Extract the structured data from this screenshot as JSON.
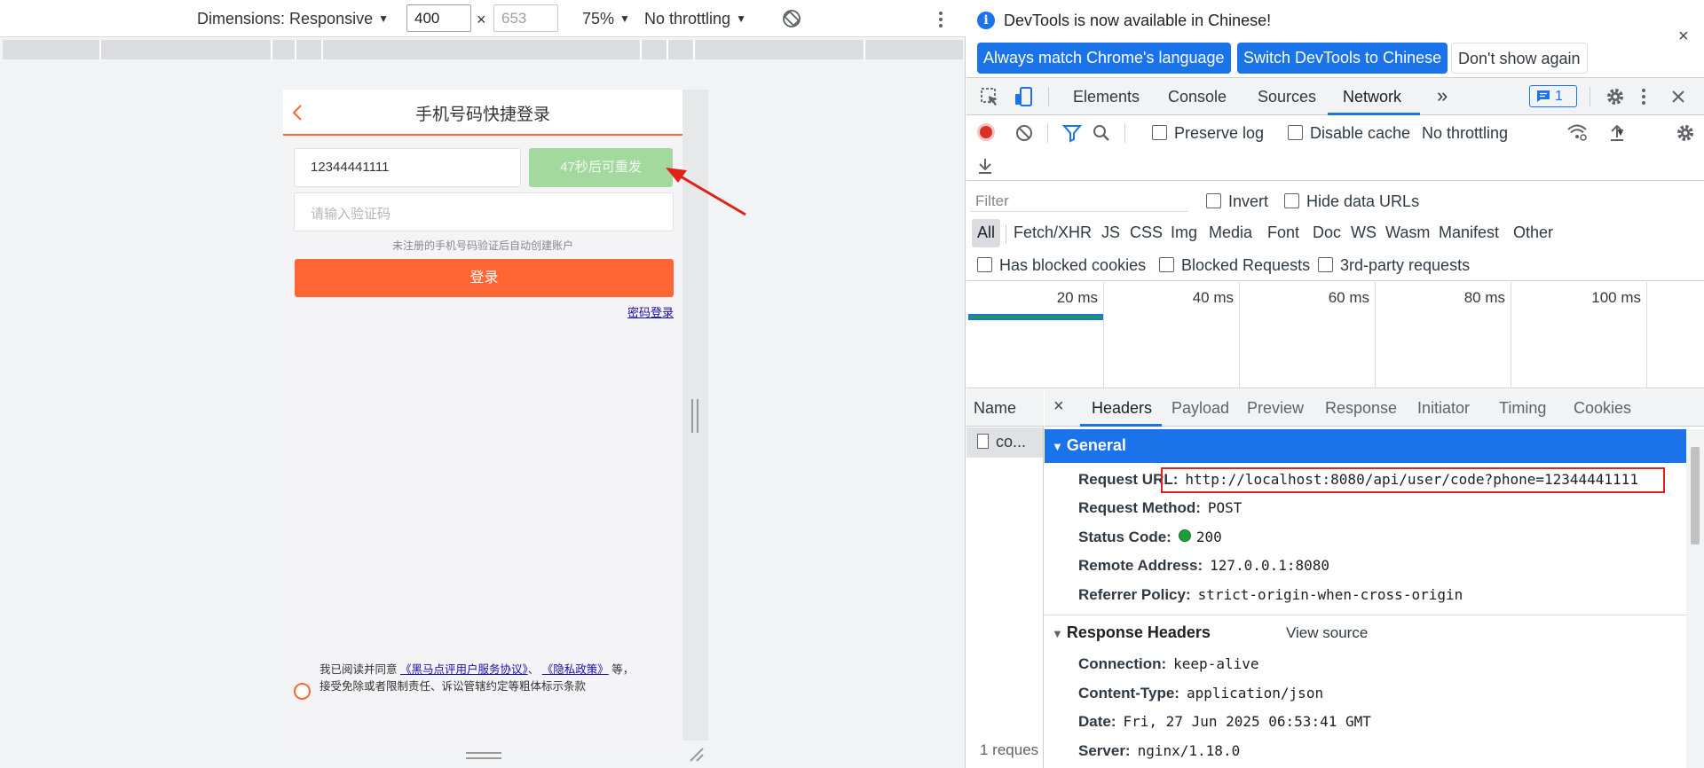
{
  "device_toolbar": {
    "dimensions_label": "Dimensions: Responsive",
    "width": "400",
    "height_placeholder": "653",
    "times": "×",
    "zoom": "75%",
    "throttling": "No throttling"
  },
  "phone_page": {
    "title": "手机号码快捷登录",
    "phone_value": "12344441111",
    "resend_label": "47秒后可重发",
    "code_placeholder": "请输入验证码",
    "hint": "未注册的手机号码验证后自动创建账户",
    "login_label": "登录",
    "password_login": "密码登录",
    "agreement_prefix": "我已阅读并同意",
    "agreement_link1": "《黑马点评用户服务协议》",
    "agreement_sep": "、",
    "agreement_link2": "《隐私政策》",
    "agreement_suffix": "等，",
    "agreement_line2": "接受免除或者限制责任、诉讼管辖约定等粗体标示条款"
  },
  "devtools": {
    "infobar": {
      "message": "DevTools is now available in Chinese!",
      "btn_match": "Always match Chrome's language",
      "btn_switch": "Switch DevTools to Chinese",
      "btn_dismiss": "Don't show again",
      "close": "×"
    },
    "tabs": {
      "elements": "Elements",
      "console": "Console",
      "sources": "Sources",
      "network": "Network",
      "more": "»",
      "issues_count": "1"
    },
    "network_toolbar": {
      "preserve_log": "Preserve log",
      "disable_cache": "Disable cache",
      "throttling": "No throttling"
    },
    "filter": {
      "placeholder": "Filter",
      "invert": "Invert",
      "hide_data_urls": "Hide data URLs",
      "types": [
        "All",
        "Fetch/XHR",
        "JS",
        "CSS",
        "Img",
        "Media",
        "Font",
        "Doc",
        "WS",
        "Wasm",
        "Manifest",
        "Other"
      ],
      "has_blocked_cookies": "Has blocked cookies",
      "blocked_requests": "Blocked Requests",
      "third_party": "3rd-party requests"
    },
    "overview": {
      "ticks": [
        "20 ms",
        "40 ms",
        "60 ms",
        "80 ms",
        "100 ms"
      ]
    },
    "request_list": {
      "header": "Name",
      "row_name": "co...",
      "footer": "1 reques"
    },
    "detail_tabs": {
      "close": "×",
      "headers": "Headers",
      "payload": "Payload",
      "preview": "Preview",
      "response": "Response",
      "initiator": "Initiator",
      "timing": "Timing",
      "cookies": "Cookies"
    },
    "general": {
      "title": "General",
      "request_url_key": "Request URL:",
      "request_url": "http://localhost:8080/api/user/code?phone=12344441111",
      "request_method_key": "Request Method:",
      "request_method": "POST",
      "status_code_key": "Status Code:",
      "status_code": "200",
      "remote_address_key": "Remote Address:",
      "remote_address": "127.0.0.1:8080",
      "referrer_policy_key": "Referrer Policy:",
      "referrer_policy": "strict-origin-when-cross-origin"
    },
    "response_headers": {
      "title": "Response Headers",
      "view_source": "View source",
      "connection_key": "Connection:",
      "connection": "keep-alive",
      "content_type_key": "Content-Type:",
      "content_type": "application/json",
      "date_key": "Date:",
      "date": "Fri, 27 Jun 2025 06:53:41 GMT",
      "server_key": "Server:",
      "server": "nginx/1.18.0"
    }
  },
  "colors": {
    "accent_orange": "#ff6633",
    "resend_green": "#a3d99e",
    "devtools_blue": "#1a73e8",
    "annotation_red": "#e0221a"
  }
}
